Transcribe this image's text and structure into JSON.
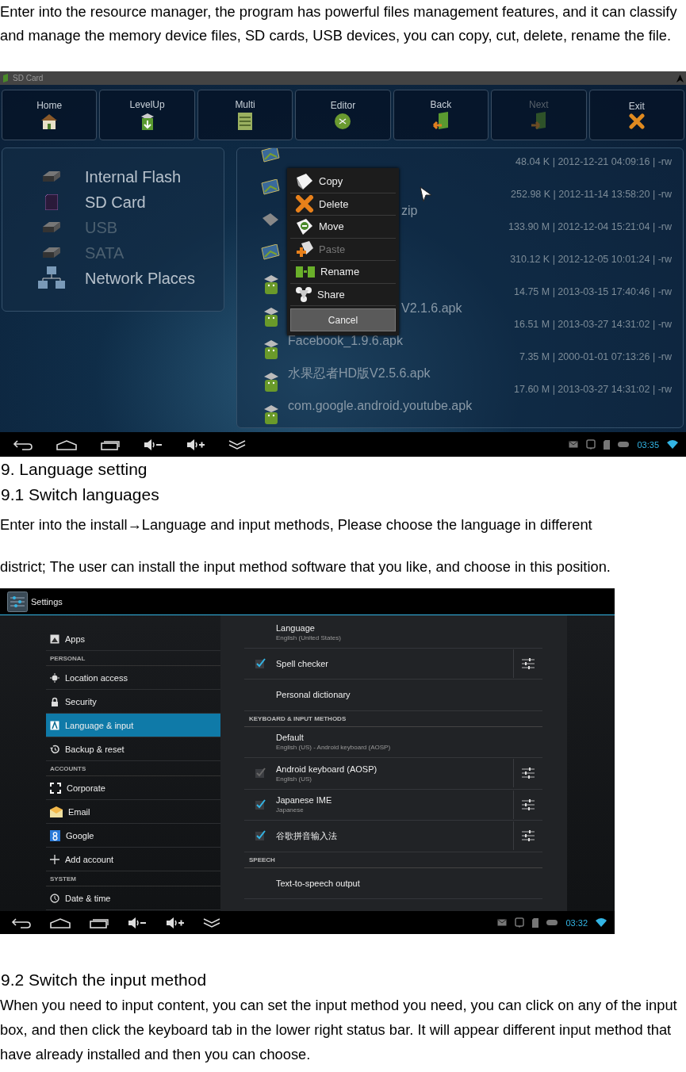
{
  "intro": "Enter into the resource manager, the program has powerful files management features, and it can classify and manage the memory device files, SD cards, USB devices, you can copy, cut, delete, rename the file.",
  "file_manager": {
    "title": "SD Card",
    "toolbar": [
      {
        "label": "Home",
        "disabled": false
      },
      {
        "label": "LevelUp",
        "disabled": false
      },
      {
        "label": "Multi",
        "disabled": false
      },
      {
        "label": "Editor",
        "disabled": false
      },
      {
        "label": "Back",
        "disabled": false
      },
      {
        "label": "Next",
        "disabled": true
      },
      {
        "label": "Exit",
        "disabled": false
      }
    ],
    "storage": [
      {
        "kind": "drive",
        "label": "Internal Flash",
        "disabled": false
      },
      {
        "kind": "sd",
        "label": "SD Card",
        "disabled": false
      },
      {
        "kind": "drive",
        "label": "USB",
        "disabled": true
      },
      {
        "kind": "drive",
        "label": "SATA",
        "disabled": true
      },
      {
        "kind": "network",
        "label": "Network Places",
        "disabled": false
      }
    ],
    "files": [
      {
        "kind": "image",
        "meta": "48.04 K | 2012-12-21 04:09:16 | -rw"
      },
      {
        "kind": "image",
        "meta": "252.98 K | 2012-11-14 13:58:20 | -rw"
      },
      {
        "kind": "archive",
        "name": "zip",
        "covered": true,
        "meta": "133.90 M | 2012-12-04 15:21:04 | -rw"
      },
      {
        "kind": "image",
        "meta": "310.12 K | 2012-12-05 10:01:24 | -rw"
      },
      {
        "kind": "apk",
        "meta": "14.75 M | 2013-03-15 17:40:46 | -rw"
      },
      {
        "kind": "apk",
        "name": "V2.1.6.apk",
        "covered": true,
        "meta": "16.51 M | 2013-03-27 14:31:02 | -rw"
      },
      {
        "kind": "apk",
        "name": "Facebook_1.9.6.apk",
        "covered": false,
        "meta": "7.35 M | 2000-01-01 07:13:26 | -rw"
      },
      {
        "kind": "apk",
        "name": "水果忍者HD版V2.5.6.apk",
        "covered": false,
        "meta": "17.60 M | 2013-03-27 14:31:02 | -rw"
      },
      {
        "kind": "apk",
        "name": "com.google.android.youtube.apk",
        "covered": false
      }
    ],
    "menu": [
      {
        "label": "Copy",
        "disabled": false
      },
      {
        "label": "Delete",
        "disabled": false
      },
      {
        "label": "Move",
        "disabled": false
      },
      {
        "label": "Paste",
        "disabled": true
      },
      {
        "label": "Rename",
        "disabled": false
      },
      {
        "label": "Share",
        "disabled": false
      }
    ],
    "cancel": "Cancel",
    "nav_bar": {
      "time": "03:35"
    }
  },
  "heading_1": "9. Language setting",
  "heading_2": "9.1 Switch languages",
  "text_2": [
    "Enter into the install→Language and input methods, Please choose the language in different",
    "district; The user can install the input method software that you like, and choose in this position."
  ],
  "settings": {
    "title": "Settings",
    "sidebar": [
      {
        "kind": "item",
        "label": "Apps",
        "selected": false
      },
      {
        "kind": "header",
        "label": "PERSONAL"
      },
      {
        "kind": "item",
        "label": "Location access",
        "selected": false
      },
      {
        "kind": "item",
        "label": "Security",
        "selected": false
      },
      {
        "kind": "item",
        "label": "Language & input",
        "selected": true
      },
      {
        "kind": "item",
        "label": "Backup & reset",
        "selected": false
      },
      {
        "kind": "header",
        "label": "ACCOUNTS"
      },
      {
        "kind": "item",
        "label": "Corporate",
        "selected": false
      },
      {
        "kind": "item",
        "label": "Email",
        "selected": false
      },
      {
        "kind": "item",
        "label": "Google",
        "selected": false
      },
      {
        "kind": "item",
        "label": "Add account",
        "selected": false
      },
      {
        "kind": "header",
        "label": "SYSTEM"
      },
      {
        "kind": "item",
        "label": "Date & time",
        "selected": false
      }
    ],
    "options": [
      {
        "kind": "plain",
        "title": "Language",
        "subtitle": "English (United States)"
      },
      {
        "kind": "check",
        "title": "Spell checker",
        "checked": true,
        "disabled": false
      },
      {
        "kind": "plain",
        "title": "Personal dictionary"
      },
      {
        "kind": "header",
        "title": "KEYBOARD & INPUT METHODS"
      },
      {
        "kind": "plain",
        "title": "Default",
        "subtitle": "English (US) - Android keyboard (AOSP)"
      },
      {
        "kind": "check",
        "title": "Android keyboard (AOSP)",
        "subtitle": "English (US)",
        "checked": true,
        "disabled": true
      },
      {
        "kind": "check",
        "title": "Japanese IME",
        "subtitle": "Japanese",
        "checked": true,
        "disabled": false
      },
      {
        "kind": "check",
        "title": "谷歌拼音输入法",
        "checked": true,
        "disabled": false
      },
      {
        "kind": "header",
        "title": "SPEECH"
      },
      {
        "kind": "plain",
        "title": "Text-to-speech output"
      }
    ],
    "nav_bar": {
      "time": "03:32"
    }
  },
  "heading_3": "9.2 Switch the input method",
  "text_3": "When you need to input content, you can set the input method you need, you can click on any of the input box, and then click the keyboard tab in the lower right status bar. It will appear different input method that have already installed and then you can choose."
}
